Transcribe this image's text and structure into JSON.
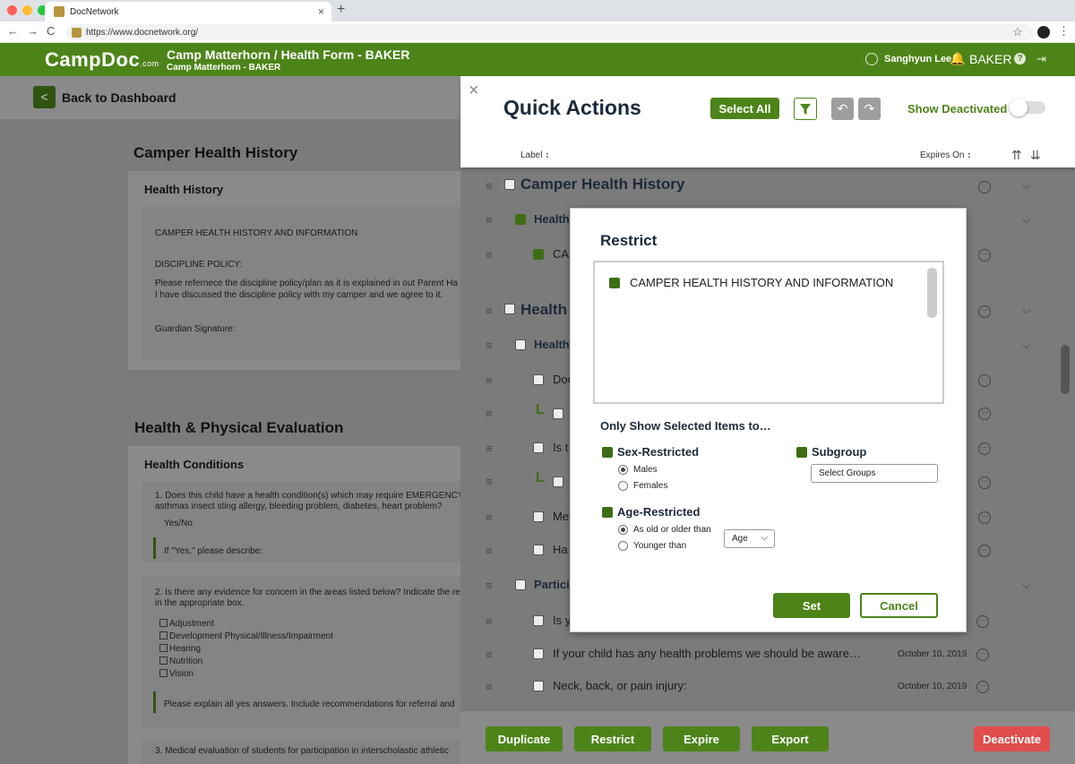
{
  "browser": {
    "tab_title": "DocNetwork",
    "tab_close": "×",
    "new_tab": "+",
    "url": "https://www.docnetwork.org/",
    "back": "←",
    "forward": "→",
    "reload": "C",
    "star": "☆",
    "kebab": "⋮"
  },
  "header": {
    "logo": "CampDoc",
    "logo_suffix": ".com",
    "title": "Camp Matterhorn / Health Form - BAKER",
    "subtitle": "Camp Matterhorn - BAKER",
    "user": "Sanghyun Lee",
    "camper": "BAKER",
    "bell": "🔔",
    "help": "?",
    "logout": "⇥"
  },
  "background_page": {
    "back_icon": "<",
    "back_label": "Back to Dashboard",
    "section1_title": "Camper Health History",
    "card1_title": "Health History",
    "card1_text1": "CAMPER HEALTH HISTORY AND INFORMATION",
    "card1_text2": "DISCIPLINE POLICY:",
    "card1_text3": "Please refernece the discipline policy/plan as it is explained in out Parent Ha",
    "card1_text4": "I have discussed the discipline policy with my camper and we agree to it.",
    "card1_text5": "Guardian Signature:",
    "section2_title": "Health & Physical Evaluation",
    "card2_title": "Health Conditions",
    "q1_line1": "1. Does this child have a health condition(s) which may require EMERGENCY",
    "q1_line2": "asthmas insect sting allergy, bleeding problem, diabetes, heart problem?",
    "q1_answer": "Yes/No",
    "q1_describe": "If \"Yes,\" please describe:",
    "q2_line1": "2. Is there any evidence for concern in the areas listed below? Indicate the re",
    "q2_line2": "in the appropriate box.",
    "q2_options": [
      "Adjustment",
      "Development Physical/Illness/Impairment",
      "Hearing",
      "Nutrition",
      "Vision"
    ],
    "q2_explain": "Please explain all yes answers. Include recommendations for referral and",
    "q3_line1": "3. Medical evaluation of students for participation in interscholastic athletic"
  },
  "panel": {
    "close": "×",
    "title": "Quick Actions",
    "select_all": "Select All",
    "undo": "↶",
    "redo": "↷",
    "show_deactivated": "Show Deactivated",
    "show_deactivated_on": false,
    "col_label": "Label ↕",
    "col_expires": "Expires On ↕",
    "sort_asc": "⇈",
    "sort_desc": "⇊",
    "drag_icon": "≡",
    "more_icon": "···",
    "chevron": "⌵",
    "child_mark": "L",
    "rows": [
      {
        "label": "Camper Health History",
        "date": ""
      },
      {
        "label": "Health",
        "date": ""
      },
      {
        "label": "CA",
        "date": ""
      },
      {
        "label": "Health",
        "date": ""
      },
      {
        "label": "Health",
        "date": ""
      },
      {
        "label": "Doc",
        "date": ""
      },
      {
        "label": "",
        "date": ""
      },
      {
        "label": "Is t",
        "date": ""
      },
      {
        "label": "",
        "date": ""
      },
      {
        "label": "Me",
        "date": ""
      },
      {
        "label": "Ha",
        "date": ""
      },
      {
        "label": "Partici",
        "date": ""
      },
      {
        "label": "Is y",
        "date": ""
      },
      {
        "label": "If your child has any health problems we should be aware…",
        "date": "October 10, 2019"
      },
      {
        "label": "Neck, back, or pain injury:",
        "date": "October 10, 2019"
      }
    ],
    "footer": {
      "duplicate": "Duplicate",
      "restrict": "Restrict",
      "expire": "Expire",
      "export": "Export",
      "deactivate": "Deactivate"
    }
  },
  "modal": {
    "title": "Restrict",
    "selected_item": "CAMPER HEALTH HISTORY AND INFORMATION",
    "subtitle": "Only Show Selected Items to…",
    "sex_label": "Sex-Restricted",
    "sex_options": [
      "Males",
      "Females"
    ],
    "sex_selected": "Males",
    "subgroup_label": "Subgroup",
    "subgroup_select": "Select Groups",
    "age_label": "Age-Restricted",
    "age_options": [
      "As old or older than",
      "Younger than"
    ],
    "age_selected": "As old or older than",
    "age_select": "Age",
    "age_chevron": "⌵",
    "set": "Set",
    "cancel": "Cancel"
  },
  "colors": {
    "brand_green": "#4d8419",
    "dark_green": "#3e6e13",
    "danger_red": "#e04d4d",
    "title_navy": "#1c2a39"
  }
}
